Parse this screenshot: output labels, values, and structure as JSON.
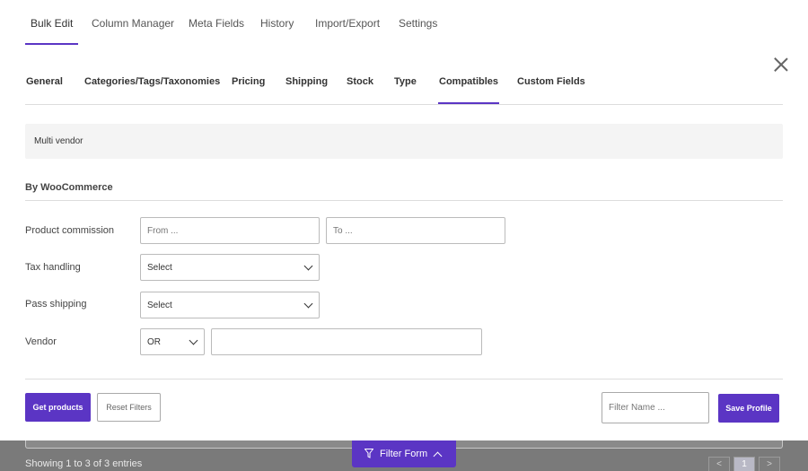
{
  "top_tabs": [
    {
      "label": "Bulk Edit",
      "active": true
    },
    {
      "label": "Column Manager",
      "active": false
    },
    {
      "label": "Meta Fields",
      "active": false
    },
    {
      "label": "History",
      "active": false
    },
    {
      "label": "Import/Export",
      "active": false
    },
    {
      "label": "Settings",
      "active": false
    }
  ],
  "filter_tabs": [
    {
      "label": "General",
      "active": false
    },
    {
      "label": "Categories/Tags/Taxonomies",
      "active": false
    },
    {
      "label": "Pricing",
      "active": false
    },
    {
      "label": "Shipping",
      "active": false
    },
    {
      "label": "Stock",
      "active": false
    },
    {
      "label": "Type",
      "active": false
    },
    {
      "label": "Compatibles",
      "active": true
    },
    {
      "label": "Custom Fields",
      "active": false
    }
  ],
  "multi_vendor_label": "Multi vendor",
  "section_title": "By WooCommerce",
  "fields": {
    "product_commission": {
      "label": "Product commission",
      "from_placeholder": "From ...",
      "to_placeholder": "To ..."
    },
    "tax_handling": {
      "label": "Tax handling",
      "value": "Select"
    },
    "pass_shipping": {
      "label": "Pass shipping",
      "value": "Select"
    },
    "vendor": {
      "label": "Vendor",
      "operator": "OR",
      "value": ""
    }
  },
  "buttons": {
    "get_products": "Get products",
    "reset_filters": "Reset Filters",
    "filter_name_placeholder": "Filter Name ...",
    "save_profile": "Save Profile"
  },
  "filter_form_label": "Filter Form",
  "entries_text": "Showing 1 to 3 of 3 entries",
  "pagination": {
    "prev": "<",
    "current": "1",
    "next": ">"
  },
  "accent_color": "#5b35c4"
}
